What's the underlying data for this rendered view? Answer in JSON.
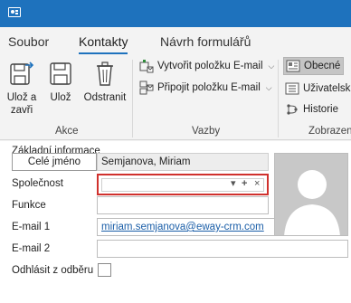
{
  "tabs": [
    "Soubor",
    "Kontakty",
    "Návrh formulářů"
  ],
  "active_tab_index": 1,
  "ribbon": {
    "actions": {
      "save_close": [
        "Ulož a",
        "zavři"
      ],
      "save": "Ulož",
      "delete": "Odstranit",
      "group_label": "Akce"
    },
    "relations": {
      "create_email": "Vytvořit položku E-mail",
      "attach_email": "Připojit položku E-mail",
      "group_label": "Vazby"
    },
    "views": {
      "general": "Obecné",
      "user": "Uživatelsk",
      "history": "Historie",
      "group_label": "Zobrazen"
    }
  },
  "form": {
    "section_title": "Základní informace",
    "fullname_button": "Celé jméno",
    "fullname_value": "Semjanova, Miriam",
    "company_label": "Společnost",
    "company_value": "",
    "company_controls": [
      "▾",
      "+",
      "×"
    ],
    "function_label": "Funkce",
    "function_value": "",
    "email1_label": "E-mail 1",
    "email1_value": "miriam.semjanova@eway-crm.com",
    "email2_label": "E-mail 2",
    "email2_value": "",
    "unsubscribe_label": "Odhlásit z odběru",
    "unsubscribe_checked": false
  },
  "colors": {
    "accent": "#1e72bd",
    "highlight_border": "#d0312d",
    "link": "#1a5ea8"
  }
}
